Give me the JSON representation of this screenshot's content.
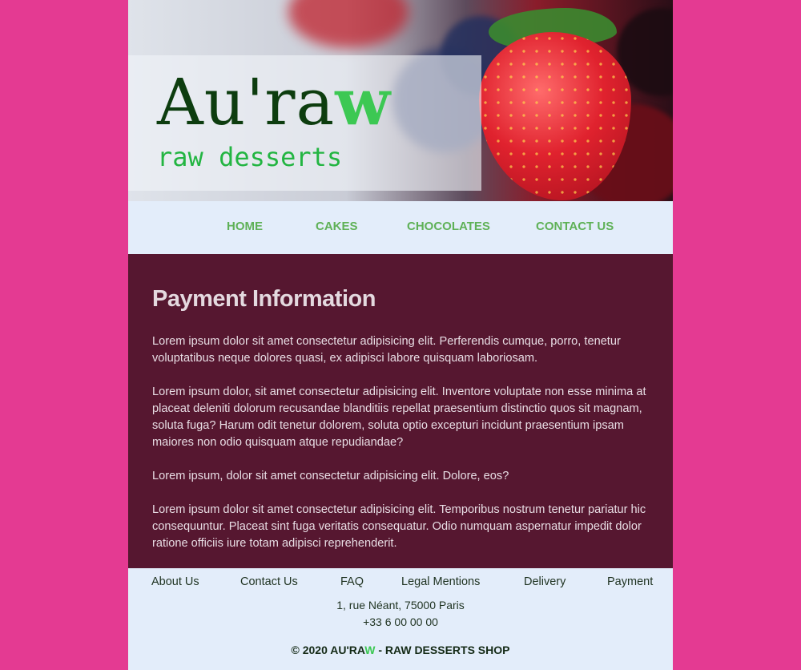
{
  "header": {
    "logo_main": "Au'ra",
    "logo_accent": "w",
    "tagline": "raw desserts"
  },
  "nav": {
    "items": [
      {
        "label": "HOME"
      },
      {
        "label": "CAKES"
      },
      {
        "label": "CHOCOLATES"
      },
      {
        "label": "CONTACT US"
      }
    ]
  },
  "main": {
    "title": "Payment Information",
    "paragraphs": [
      "Lorem ipsum dolor sit amet consectetur adipisicing elit. Perferendis cumque, porro, tenetur voluptatibus neque dolores quasi, ex adipisci labore quisquam laboriosam.",
      "Lorem ipsum dolor, sit amet consectetur adipisicing elit. Inventore voluptate non esse minima at placeat deleniti dolorum recusandae blanditiis repellat praesentium distinctio quos sit magnam, soluta fuga? Harum odit tenetur dolorem, soluta optio excepturi incidunt praesentium ipsam maiores non odio quisquam atque repudiandae?",
      "Lorem ipsum, dolor sit amet consectetur adipisicing elit. Dolore, eos?",
      "Lorem ipsum dolor sit amet consectetur adipisicing elit. Temporibus nostrum tenetur pariatur hic consequuntur. Placeat sint fuga veritatis consequatur. Odio numquam aspernatur impedit dolor ratione officiis iure totam adipisci reprehenderit."
    ]
  },
  "footer": {
    "links": [
      {
        "label": "About Us"
      },
      {
        "label": "Contact Us"
      },
      {
        "label": "FAQ"
      },
      {
        "label": "Legal Mentions"
      },
      {
        "label": "Delivery"
      },
      {
        "label": "Payment"
      }
    ],
    "address": "1, rue Néant, 75000 Paris",
    "phone": "+33 6 00 00 00",
    "copyright_prefix": "© 2020 AU'RA",
    "copyright_accent": "W",
    "copyright_suffix": " - RAW DESSERTS SHOP"
  },
  "colors": {
    "background": "#e43a92",
    "panel": "#e3edfa",
    "content_bg": "#561730",
    "accent_green": "#3cc853",
    "nav_green": "#5fb157",
    "logo_dark": "#0d3d0f"
  }
}
